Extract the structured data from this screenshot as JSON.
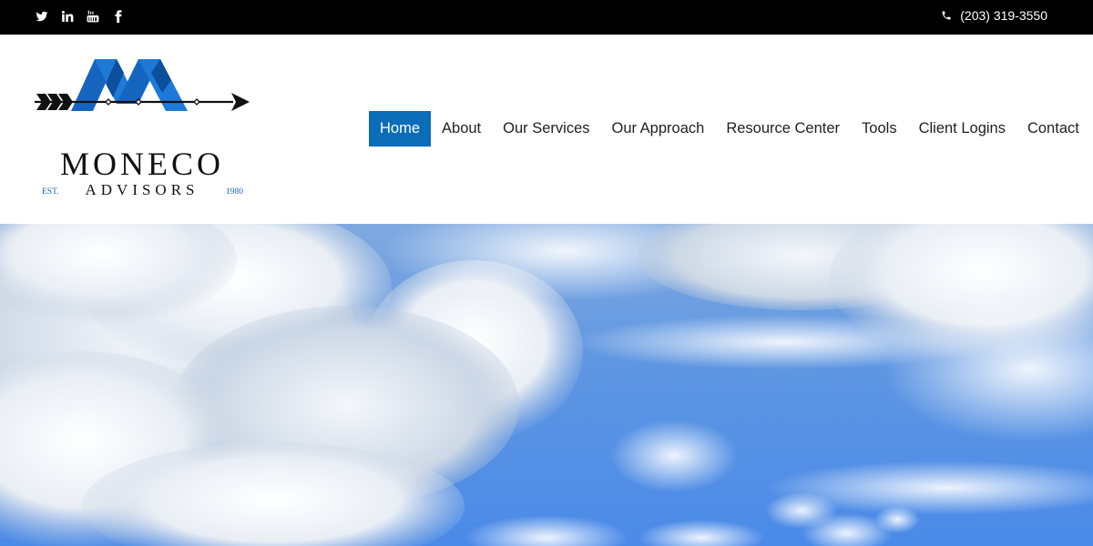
{
  "topbar": {
    "social": [
      {
        "name": "twitter-icon",
        "label": "Twitter"
      },
      {
        "name": "linkedin-icon",
        "label": "LinkedIn"
      },
      {
        "name": "youtube-icon",
        "label": "YouTube"
      },
      {
        "name": "facebook-icon",
        "label": "Facebook"
      }
    ],
    "phone": "(203) 319-3550"
  },
  "logo": {
    "name": "MONECO",
    "subtitle": "ADVISORS",
    "est": "EST.",
    "year": "1980",
    "brand_color": "#1565c0"
  },
  "nav": {
    "items": [
      {
        "label": "Home",
        "active": true
      },
      {
        "label": "About",
        "active": false
      },
      {
        "label": "Our Services",
        "active": false
      },
      {
        "label": "Our Approach",
        "active": false
      },
      {
        "label": "Resource Center",
        "active": false
      },
      {
        "label": "Tools",
        "active": false
      },
      {
        "label": "Client Logins",
        "active": false
      },
      {
        "label": "Contact",
        "active": false
      }
    ],
    "active_color": "#0b6cb8"
  },
  "hero": {
    "image": "sky-with-clouds"
  }
}
